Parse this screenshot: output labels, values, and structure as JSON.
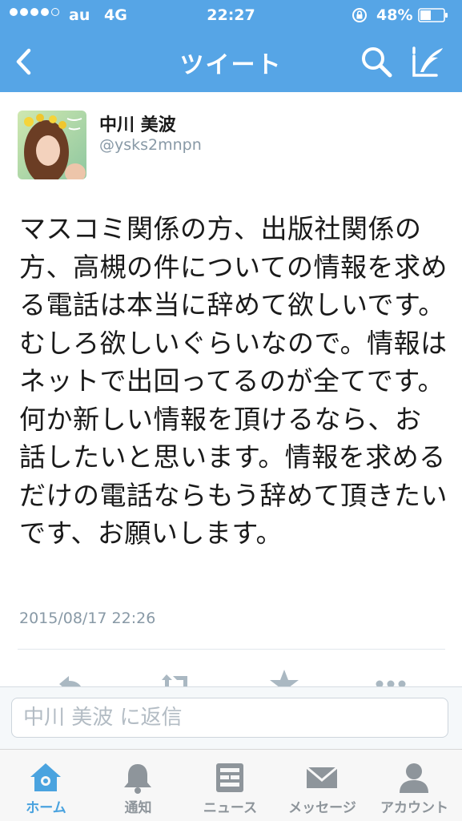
{
  "status_bar": {
    "carrier": "au",
    "network": "4G",
    "time": "22:27",
    "battery_percent": "48%",
    "signal_bars": 4
  },
  "nav": {
    "title": "ツイート",
    "back_icon": "chevron-left-icon",
    "search_icon": "search-icon",
    "compose_icon": "compose-icon"
  },
  "tweet": {
    "display_name": "中川 美波",
    "handle": "@ysks2mnpn",
    "text": "マスコミ関係の方、出版社関係の方、高槻の件についての情報を求める電話は本当に辞めて欲しいです。むしろ欲しいぐらいなので。情報はネットで出回ってるのが全てです。何か新しい情報を頂けるなら、お話したいと思います。情報を求めるだけの電話ならもう辞めて頂きたいです、お願いします。",
    "timestamp": "2015/08/17 22:26"
  },
  "reply": {
    "placeholder": "中川 美波 に返信"
  },
  "tabs": [
    {
      "label": "ホーム",
      "icon": "home-icon",
      "active": true
    },
    {
      "label": "通知",
      "icon": "bell-icon",
      "active": false
    },
    {
      "label": "ニュース",
      "icon": "news-icon",
      "active": false
    },
    {
      "label": "メッセージ",
      "icon": "envelope-icon",
      "active": false
    },
    {
      "label": "アカウント",
      "icon": "person-icon",
      "active": false
    }
  ],
  "colors": {
    "header": "#56a5e6",
    "active_tab": "#4aa3df",
    "inactive_tab": "#8e959b",
    "meta_text": "#8899a6"
  }
}
